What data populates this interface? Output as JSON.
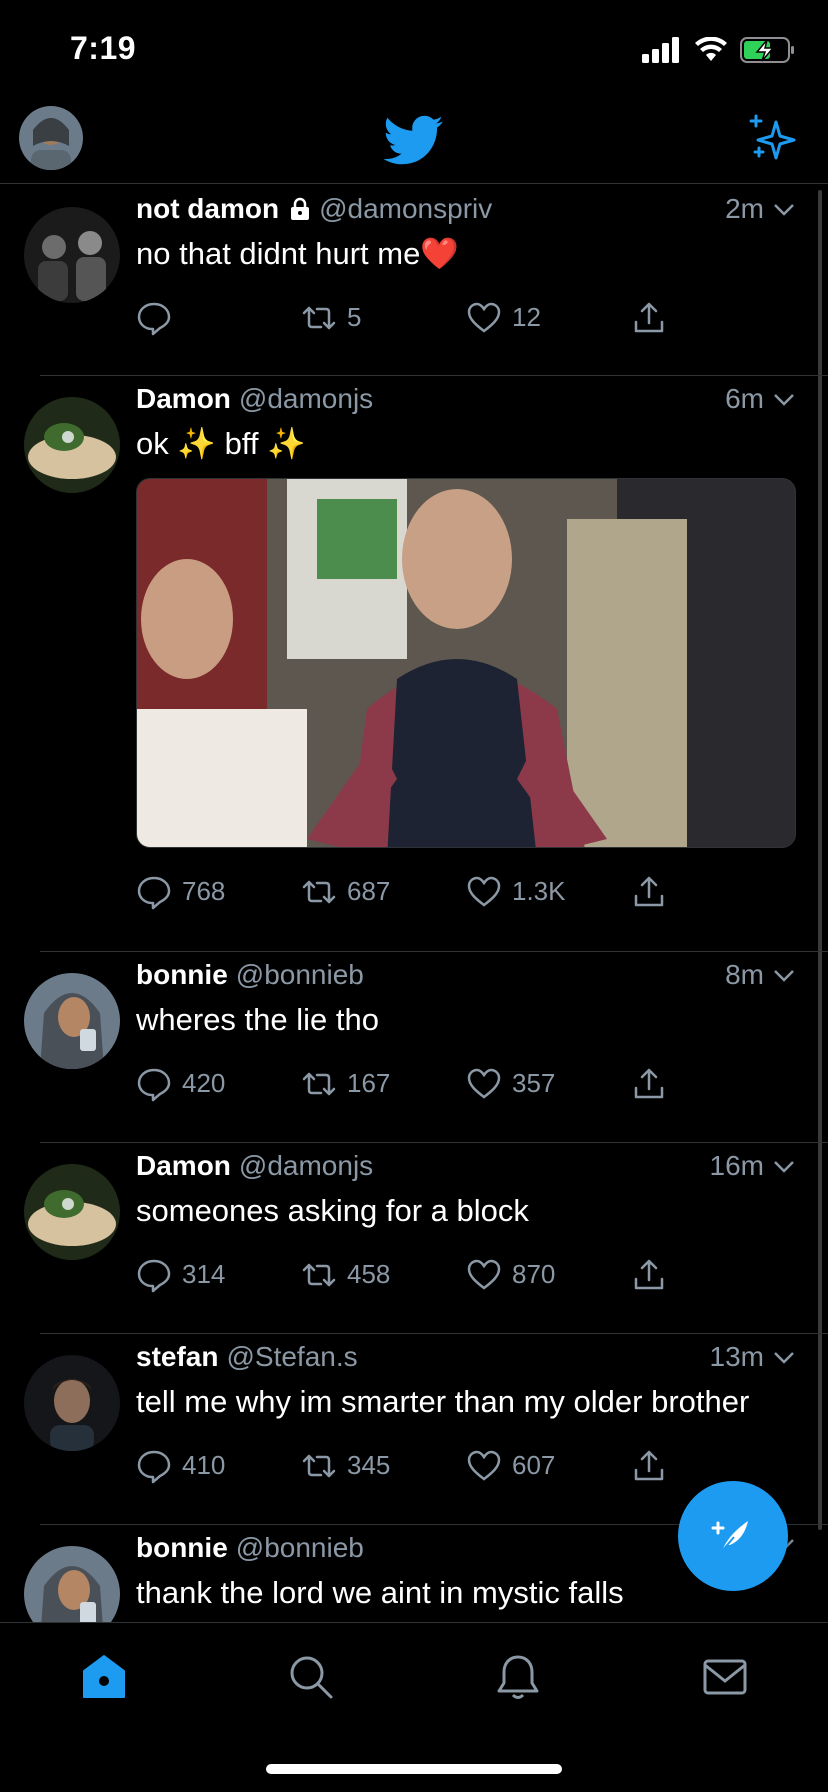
{
  "status": {
    "time": "7:19"
  },
  "colors": {
    "accent": "#1d9bf0",
    "secondary_text": "#8b98a5",
    "separator": "#2f3336",
    "heart": "#e0245e"
  },
  "nav": {
    "logo_icon": "twitter-bird-icon",
    "sparkle_icon": "sparkle-icon"
  },
  "tweets": [
    {
      "name": "not damon",
      "handle": "@damonspriv",
      "time": "2m",
      "text": "no that didnt hurt me❤️",
      "locked": true,
      "replies": "",
      "retweets": "5",
      "likes": "12"
    },
    {
      "name": "Damon",
      "handle": "@damonjs",
      "time": "6m",
      "text": "ok ✨ bff ✨",
      "replies": "768",
      "retweets": "687",
      "likes": "1.3K"
    },
    {
      "name": "bonnie",
      "handle": "@bonnieb",
      "time": "8m",
      "text": "wheres the lie tho",
      "replies": "420",
      "retweets": "167",
      "likes": "357"
    },
    {
      "name": "Damon",
      "handle": "@damonjs",
      "time": "16m",
      "text": "someones asking for a block",
      "replies": "314",
      "retweets": "458",
      "likes": "870"
    },
    {
      "name": "stefan",
      "handle": "@Stefan.s",
      "time": "13m",
      "text": "tell me why im smarter than my older brother",
      "replies": "410",
      "retweets": "345",
      "likes": "607"
    },
    {
      "name": "bonnie",
      "handle": "@bonnieb",
      "time": "",
      "text": "thank the lord we aint in mystic falls"
    }
  ],
  "tabs": [
    "home-icon",
    "search-icon",
    "notifications-icon",
    "messages-icon"
  ]
}
